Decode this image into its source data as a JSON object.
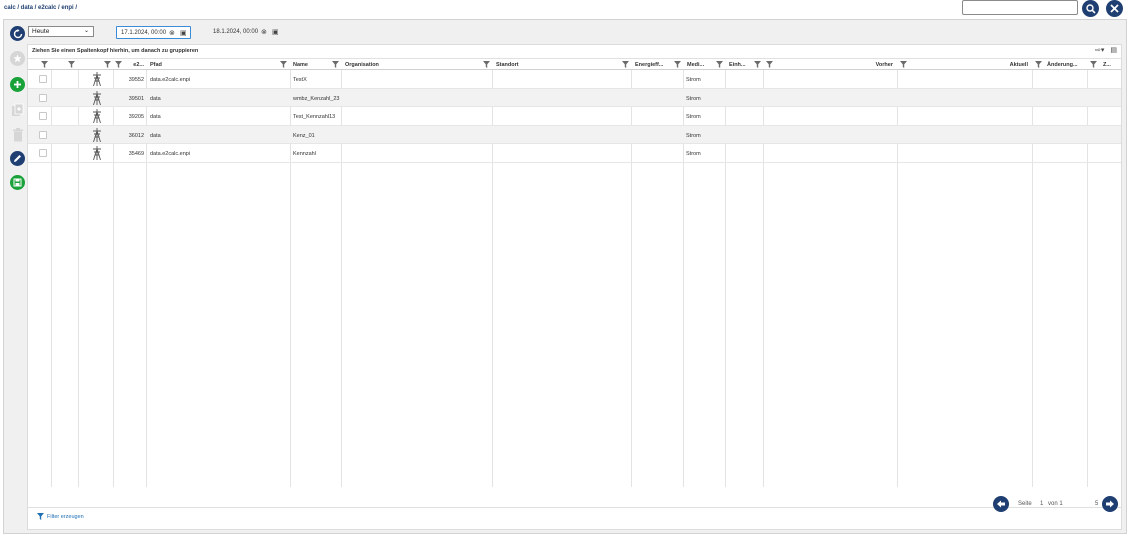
{
  "breadcrumb": "calc / data / e2calc / enpi /",
  "top_search": {
    "value": ""
  },
  "filters": {
    "period": "Heute",
    "date_from": "17.1.2024, 00:00",
    "date_to": "18.1.2024, 00:00"
  },
  "grid": {
    "group_hint": "Ziehen Sie einen Spaltenkopf hierhin, um danach zu gruppieren",
    "columns": {
      "id": "e2...",
      "pfad": "Pfad",
      "name": "Name",
      "organisation": "Organisation",
      "standort": "Standort",
      "energie": "Energieff...",
      "medium": "Medi...",
      "einheit": "Einh...",
      "vorher": "Vorher",
      "aktuell": "Aktuell",
      "aenderung": "Änderung...",
      "z": "Z..."
    },
    "rows": [
      {
        "id": "39552",
        "pfad": "data.e2calc.enpi",
        "name": "TestX",
        "medium": "Strom"
      },
      {
        "id": "39501",
        "pfad": "data",
        "name": "wmbz_Kenzahl_23",
        "medium": "Strom"
      },
      {
        "id": "39205",
        "pfad": "data",
        "name": "Test_Kennzahl13",
        "medium": "Strom"
      },
      {
        "id": "36012",
        "pfad": "data",
        "name": "Kenz_01",
        "medium": "Strom"
      },
      {
        "id": "35469",
        "pfad": "data.e2calc.enpi",
        "name": "Kennzahl",
        "medium": "Strom"
      }
    ],
    "filter_create": "Filter erzeugen"
  },
  "pager": {
    "label": "Seite",
    "page": "1",
    "of": "von 1",
    "size": "5"
  },
  "colors": {
    "primary": "#1f3f72",
    "success": "#19a13a",
    "accent": "#1f6fb5"
  },
  "icons": [
    "search-icon",
    "close-icon",
    "refresh-icon",
    "star-icon",
    "add-icon",
    "copy-icon",
    "delete-icon",
    "edit-icon",
    "save-icon",
    "filter-icon",
    "pylon-icon",
    "calendar-icon",
    "clear-icon"
  ]
}
